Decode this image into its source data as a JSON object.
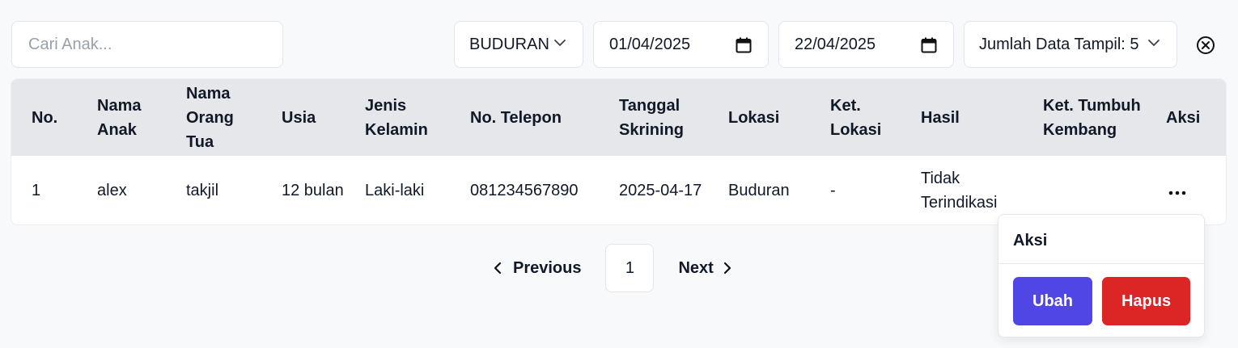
{
  "filters": {
    "search_placeholder": "Cari Anak...",
    "search_value": "",
    "location_value": "BUDURAN",
    "date_from": "01/04/2025",
    "date_to": "22/04/2025",
    "page_size_value": "Jumlah Data Tampil: 5"
  },
  "table": {
    "headers": {
      "no": "No.",
      "nama_anak": "Nama Anak",
      "nama_orang_tua": "Nama Orang Tua",
      "usia": "Usia",
      "jenis_kelamin": "Jenis Kelamin",
      "no_telepon": "No. Telepon",
      "tanggal_skrining": "Tanggal Skrining",
      "lokasi": "Lokasi",
      "ket_lokasi": "Ket. Lokasi",
      "hasil": "Hasil",
      "ket_tumbuh_kembang": "Ket. Tumbuh Kembang",
      "aksi": "Aksi"
    },
    "rows": [
      {
        "no": "1",
        "nama_anak": "alex",
        "nama_orang_tua": "takjil",
        "usia": "12 bulan",
        "jenis_kelamin": "Laki-laki",
        "no_telepon": "081234567890",
        "tanggal_skrining": "2025-04-17",
        "lokasi": "Buduran",
        "ket_lokasi": "-",
        "hasil": "Tidak Terindikasi",
        "ket_tumbuh_kembang": "",
        "aksi": "..."
      }
    ]
  },
  "pagination": {
    "previous_label": "Previous",
    "current_page": "1",
    "next_label": "Next"
  },
  "action_menu": {
    "title": "Aksi",
    "edit_label": "Ubah",
    "delete_label": "Hapus"
  },
  "colors": {
    "edit_button": "#4f46e5",
    "delete_button": "#dc2626",
    "header_background": "#e5e7eb"
  },
  "icons": {
    "location_dropdown": "chevron-down-icon",
    "page_size_dropdown": "chevron-down-icon",
    "date_from_picker": "calendar-icon",
    "date_to_picker": "calendar-icon",
    "clear_filters": "close-circle-icon",
    "previous": "chevron-left-icon",
    "next": "chevron-right-icon",
    "row_actions": "more-horizontal-icon"
  }
}
